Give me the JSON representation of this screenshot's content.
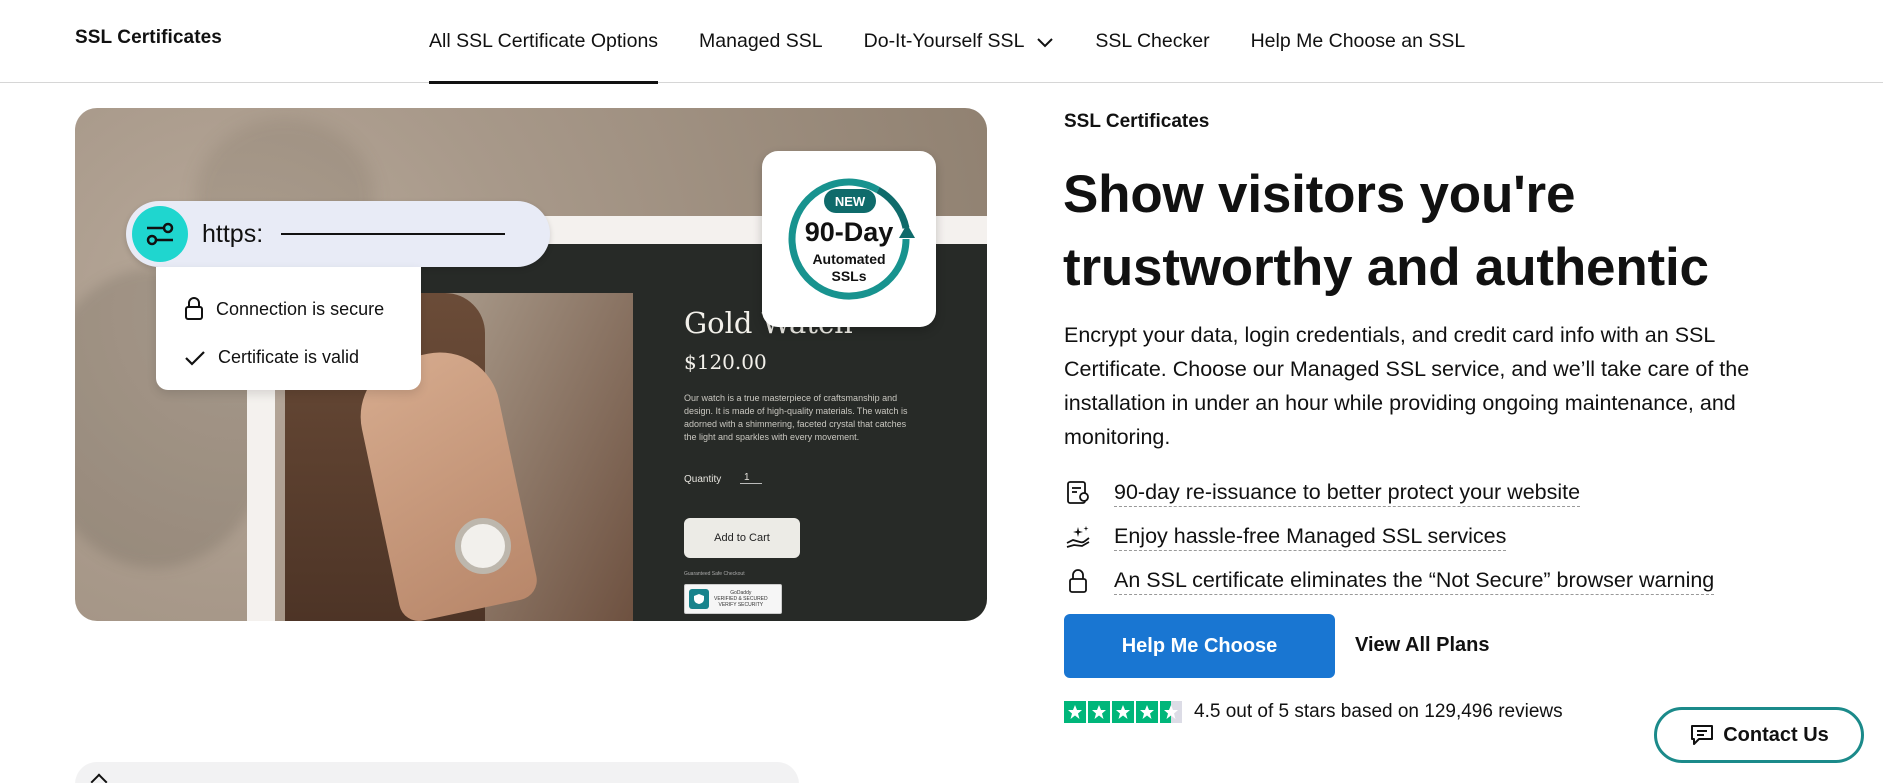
{
  "nav": {
    "brand": "SSL Certificates",
    "links": [
      {
        "label": "All SSL Certificate Options",
        "active": true
      },
      {
        "label": "Managed SSL"
      },
      {
        "label": "Do-It-Yourself SSL",
        "dropdown": true
      },
      {
        "label": "SSL Checker"
      },
      {
        "label": "Help Me Choose an SSL"
      }
    ]
  },
  "hero_image": {
    "url_prefix": "https:",
    "security_checks": [
      "Connection is secure",
      "Certificate is valid"
    ],
    "badge": {
      "tag": "NEW",
      "title": "90-Day",
      "subtitle_1": "Automated",
      "subtitle_2": "SSLs"
    },
    "product": {
      "title": "Gold Watch",
      "price": "$120.00",
      "description": "Our watch is a true masterpiece of craftsmanship and design. It is made of high-quality materials. The watch is adorned with a shimmering, faceted crystal that catches the light and sparkles with every movement.",
      "quantity_label": "Quantity",
      "quantity_value": "1",
      "cart_button": "Add to Cart",
      "checkout_label": "Guaranteed Safe Checkout",
      "seal_line_1": "GoDaddy",
      "seal_line_2": "VERIFIED & SECURED",
      "seal_line_3": "VERIFY SECURITY"
    }
  },
  "content": {
    "eyebrow": "SSL Certificates",
    "headline": "Show visitors you're trustworthy and authentic",
    "body": "Encrypt your data, login credentials, and credit card info with an SSL Certificate. Choose our Managed SSL service, and we’ll take care of the installation in under an hour while providing ongoing maintenance, and monitoring.",
    "features": [
      {
        "icon": "certificate-icon",
        "label": "90-day re-issuance to better protect your website"
      },
      {
        "icon": "sparkle-hand-icon",
        "label": "Enjoy hassle-free Managed SSL services"
      },
      {
        "icon": "lock-icon",
        "label": "An SSL certificate eliminates the “Not Secure” browser warning"
      }
    ],
    "primary_button": "Help Me Choose",
    "secondary_button": "View All Plans",
    "rating": {
      "stars": 4.5,
      "text": "4.5 out of 5 stars based on 129,496 reviews"
    }
  },
  "contact": {
    "label": "Contact Us"
  },
  "colors": {
    "primary": "#1976d2",
    "teal": "#1b8a8a",
    "star": "#00b67a",
    "accent_cyan": "#1fd6cf"
  }
}
